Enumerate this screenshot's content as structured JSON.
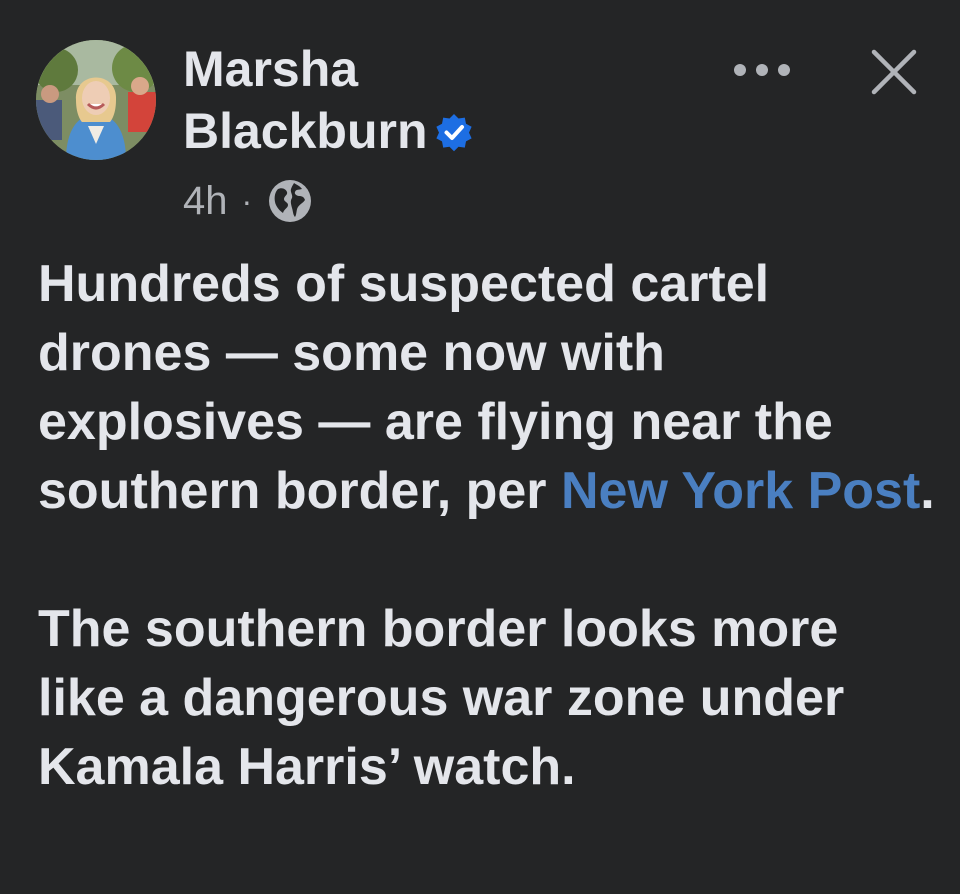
{
  "post": {
    "author": {
      "first_name": "Marsha",
      "last_name": "Blackburn",
      "verified": true
    },
    "time": "4h",
    "separator": "·",
    "audience_icon": "globe-icon",
    "more_icon": "more-horizontal-icon",
    "close_icon": "close-icon",
    "paragraph1": {
      "text_before_link": "Hundreds of suspected cartel drones — some now with explosives — are flying near the southern border, per ",
      "link_text": "New York Post",
      "text_after_link": "."
    },
    "paragraph2": "The southern border looks more like a dangerous war zone under Kamala Harris’ watch.",
    "colors": {
      "background": "#242526",
      "text": "#e4e6eb",
      "secondary_text": "#b0b3b8",
      "link": "#4a7fc1",
      "verified_badge": "#1d6ee3"
    }
  }
}
